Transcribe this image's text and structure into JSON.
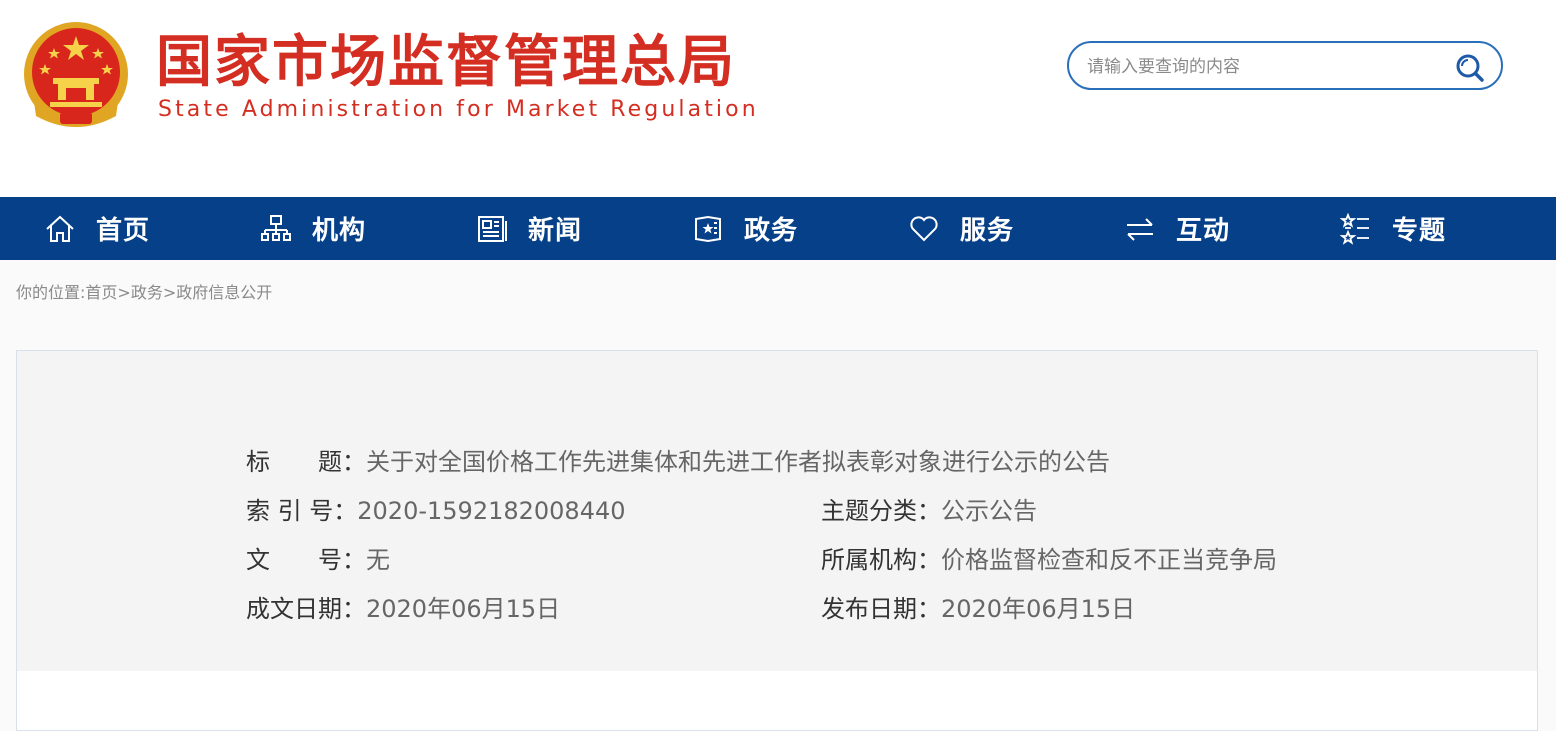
{
  "header": {
    "title_cn": "国家市场监督管理总局",
    "title_en": "State Administration for Market Regulation"
  },
  "search": {
    "placeholder": "请输入要查询的内容"
  },
  "nav": {
    "items": [
      {
        "label": "首页",
        "icon": "home-icon"
      },
      {
        "label": "机构",
        "icon": "org-chart-icon"
      },
      {
        "label": "新闻",
        "icon": "news-icon"
      },
      {
        "label": "政务",
        "icon": "government-affairs-icon"
      },
      {
        "label": "服务",
        "icon": "heart-icon"
      },
      {
        "label": "互动",
        "icon": "exchange-arrows-icon"
      },
      {
        "label": "专题",
        "icon": "topic-list-icon"
      }
    ]
  },
  "breadcrumb": {
    "prefix": "你的位置:",
    "items": [
      "首页",
      "政务",
      "政府信息公开"
    ],
    "separator": ">"
  },
  "info": {
    "title_label": "标　　题：",
    "title_value": "关于对全国价格工作先进集体和先进工作者拟表彰对象进行公示的公告",
    "index_label": "索 引 号：",
    "index_value": "2020-1592182008440",
    "category_label": "主题分类：",
    "category_value": "公示公告",
    "doc_no_label": "文　　号：",
    "doc_no_value": "无",
    "agency_label": "所属机构：",
    "agency_value": "价格监督检查和反不正当竞争局",
    "written_date_label": "成文日期：",
    "written_date_value": "2020年06月15日",
    "publish_date_label": "发布日期：",
    "publish_date_value": "2020年06月15日"
  },
  "colors": {
    "brand_red": "#d42d21",
    "nav_blue": "#064088",
    "search_border": "#2a6fba"
  }
}
